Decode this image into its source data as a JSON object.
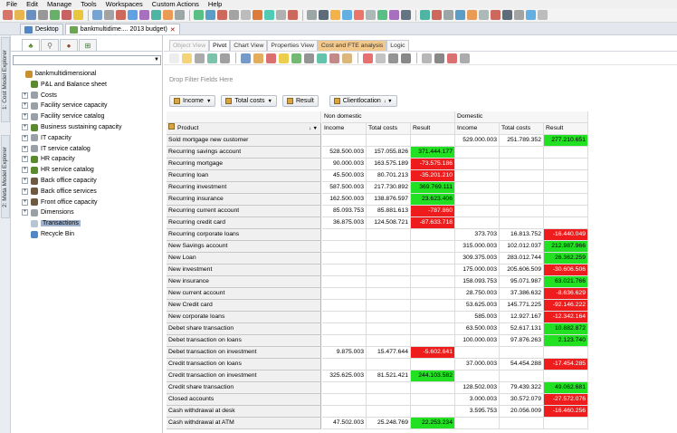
{
  "menu": [
    "File",
    "Edit",
    "Manage",
    "Tools",
    "Workspaces",
    "Custom Actions",
    "Help"
  ],
  "doc_tabs": [
    {
      "label": "Desktop"
    },
    {
      "label": "bankmultidime.... 2013 budget)"
    }
  ],
  "side_tabs": [
    "1: Cost Model Explorer",
    "2: Meta Model Explorer"
  ],
  "tree": [
    {
      "label": "bankmultidimensional",
      "level": 0,
      "exp": "",
      "icon": "#c89030"
    },
    {
      "label": "P&L and Balance sheet",
      "level": 1,
      "exp": "",
      "icon": "#5a8a2e"
    },
    {
      "label": "Costs",
      "level": 1,
      "exp": "+",
      "icon": "#9aa0a8"
    },
    {
      "label": "Facility service capacity",
      "level": 1,
      "exp": "+",
      "icon": "#9aa0a8"
    },
    {
      "label": "Facility service catalog",
      "level": 1,
      "exp": "+",
      "icon": "#9aa0a8"
    },
    {
      "label": "Business sustaining capacity",
      "level": 1,
      "exp": "+",
      "icon": "#5a8a2e"
    },
    {
      "label": "IT capacity",
      "level": 1,
      "exp": "+",
      "icon": "#9aa0a8"
    },
    {
      "label": "IT service catalog",
      "level": 1,
      "exp": "+",
      "icon": "#9aa0a8"
    },
    {
      "label": "HR capacity",
      "level": 1,
      "exp": "+",
      "icon": "#5a8a2e"
    },
    {
      "label": "HR service catalog",
      "level": 1,
      "exp": "+",
      "icon": "#5a8a2e"
    },
    {
      "label": "Back office capacity",
      "level": 1,
      "exp": "+",
      "icon": "#6e5a40"
    },
    {
      "label": "Back office services",
      "level": 1,
      "exp": "+",
      "icon": "#6e5a40"
    },
    {
      "label": "Front office capacity",
      "level": 1,
      "exp": "+",
      "icon": "#6e5a40"
    },
    {
      "label": "Dimensions",
      "level": 1,
      "exp": "+",
      "icon": "#9aa0a8"
    },
    {
      "label": "Transactions",
      "level": 1,
      "exp": "",
      "icon": "#b7c4d4",
      "selected": true
    },
    {
      "label": "Recycle Bin",
      "level": 1,
      "exp": "",
      "icon": "#4f86c6"
    }
  ],
  "view_tabs": [
    {
      "label": "Object View",
      "state": "disabled"
    },
    {
      "label": "Pivot",
      "state": "active"
    },
    {
      "label": "Chart View",
      "state": "normal"
    },
    {
      "label": "Properties View",
      "state": "normal"
    },
    {
      "label": "Cost and FTE analysis",
      "state": "hl"
    },
    {
      "label": "Logic",
      "state": "normal"
    }
  ],
  "filter_zone": "Drop Filter Fields Here",
  "data_fields": [
    "Income",
    "Total costs",
    "Result",
    "Clientlocation"
  ],
  "row_header": "Product",
  "col_groups": [
    "Non domestic",
    "Domestic"
  ],
  "measures": [
    "Income",
    "Total costs",
    "Result"
  ],
  "rows": [
    {
      "p": "Sold mortgage new customer",
      "nd": [
        "",
        "",
        ""
      ],
      "d": [
        "529.000.003",
        "251.789.352",
        "277.210.651"
      ]
    },
    {
      "p": "Recurring savings account",
      "nd": [
        "528.500.003",
        "157.055.826",
        "371.444.177"
      ],
      "d": [
        "",
        "",
        ""
      ]
    },
    {
      "p": "Recurring mortgage",
      "nd": [
        "90.000.003",
        "163.575.189",
        "-73.575.186"
      ],
      "d": [
        "",
        "",
        ""
      ]
    },
    {
      "p": "Recurring loan",
      "nd": [
        "45.500.003",
        "80.701.213",
        "-35.201.210"
      ],
      "d": [
        "",
        "",
        ""
      ]
    },
    {
      "p": "Recurring investment",
      "nd": [
        "587.500.003",
        "217.730.892",
        "369.769.111"
      ],
      "d": [
        "",
        "",
        ""
      ]
    },
    {
      "p": "Recurring insurance",
      "nd": [
        "162.500.003",
        "138.876.597",
        "23.623.406"
      ],
      "d": [
        "",
        "",
        ""
      ]
    },
    {
      "p": "Recurring current account",
      "nd": [
        "85.093.753",
        "85.881.613",
        "-787.860"
      ],
      "d": [
        "",
        "",
        ""
      ]
    },
    {
      "p": "Recurring credit card",
      "nd": [
        "36.875.003",
        "124.508.721",
        "-87.633.718"
      ],
      "d": [
        "",
        "",
        ""
      ]
    },
    {
      "p": "Recurring corporate loans",
      "nd": [
        "",
        "",
        ""
      ],
      "d": [
        "373.703",
        "16.813.752",
        "-16.440.049"
      ]
    },
    {
      "p": "New Savings account",
      "nd": [
        "",
        "",
        ""
      ],
      "d": [
        "315.000.003",
        "102.012.037",
        "212.987.966"
      ]
    },
    {
      "p": "New Loan",
      "nd": [
        "",
        "",
        ""
      ],
      "d": [
        "309.375.003",
        "283.012.744",
        "26.362.259"
      ]
    },
    {
      "p": "New investment",
      "nd": [
        "",
        "",
        ""
      ],
      "d": [
        "175.000.003",
        "205.606.509",
        "-30.606.506"
      ]
    },
    {
      "p": "New insurance",
      "nd": [
        "",
        "",
        ""
      ],
      "d": [
        "158.093.753",
        "95.071.987",
        "63.021.766"
      ]
    },
    {
      "p": "New current account",
      "nd": [
        "",
        "",
        ""
      ],
      "d": [
        "28.750.003",
        "37.386.632",
        "-8.636.629"
      ]
    },
    {
      "p": "New Credit card",
      "nd": [
        "",
        "",
        ""
      ],
      "d": [
        "53.625.003",
        "145.771.225",
        "-92.146.222"
      ]
    },
    {
      "p": "New corporate loans",
      "nd": [
        "",
        "",
        ""
      ],
      "d": [
        "585.003",
        "12.927.167",
        "-12.342.164"
      ]
    },
    {
      "p": "Debet share transaction",
      "nd": [
        "",
        "",
        ""
      ],
      "d": [
        "63.500.003",
        "52.617.131",
        "10.882.872"
      ]
    },
    {
      "p": "Debet transaction on loans",
      "nd": [
        "",
        "",
        ""
      ],
      "d": [
        "100.000.003",
        "97.876.263",
        "2.123.740"
      ]
    },
    {
      "p": "Debet transaction on investment",
      "nd": [
        "9.875.003",
        "15.477.644",
        "-5.602.641"
      ],
      "d": [
        "",
        "",
        ""
      ]
    },
    {
      "p": "Credit transaction on loans",
      "nd": [
        "",
        "",
        ""
      ],
      "d": [
        "37.000.003",
        "54.454.288",
        "-17.454.285"
      ]
    },
    {
      "p": "Credit transaction on investment",
      "nd": [
        "325.625.003",
        "81.521.421",
        "244.103.582"
      ],
      "d": [
        "",
        "",
        ""
      ]
    },
    {
      "p": "Credit share transaction",
      "nd": [
        "",
        "",
        ""
      ],
      "d": [
        "128.502.003",
        "79.439.322",
        "49.062.681"
      ]
    },
    {
      "p": "Closed accounts",
      "nd": [
        "",
        "",
        ""
      ],
      "d": [
        "3.000.003",
        "30.572.079",
        "-27.572.076"
      ]
    },
    {
      "p": "Cash withdrawal at desk",
      "nd": [
        "",
        "",
        ""
      ],
      "d": [
        "3.595.753",
        "20.056.009",
        "-16.460.256"
      ]
    },
    {
      "p": "Cash withdrawal at ATM",
      "nd": [
        "47.502.003",
        "25.248.769",
        "22.253.234"
      ],
      "d": [
        "",
        "",
        ""
      ]
    }
  ],
  "colors": {
    "positive": "#22e022",
    "negative": "#ee1c1c",
    "highlight_tab": "#f2c98a"
  }
}
